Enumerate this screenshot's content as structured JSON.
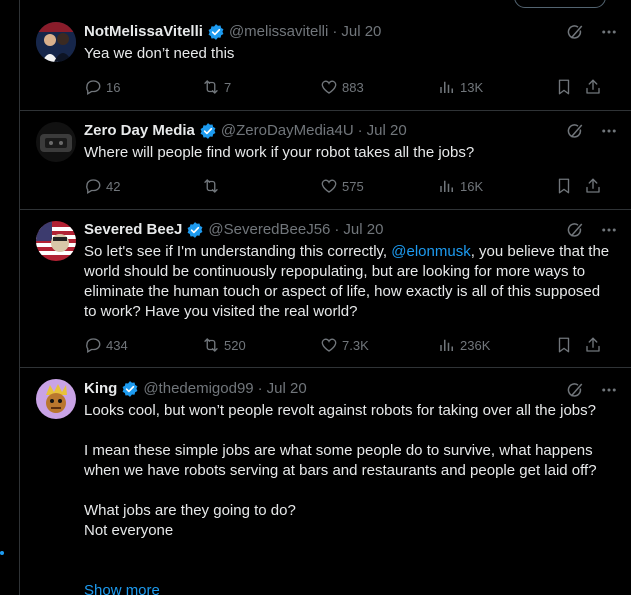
{
  "tweets": [
    {
      "name": "NotMelissaVitelli",
      "handle": "@melissavitelli",
      "date": "Jul 20",
      "text": "Yea we don’t need this",
      "replies": "16",
      "reposts": "7",
      "likes": "883",
      "views": "13K"
    },
    {
      "name": "Zero Day Media",
      "handle": "@ZeroDayMedia4U",
      "date": "Jul 20",
      "text": "Where will people find work if your robot takes all the jobs?",
      "replies": "42",
      "reposts": "",
      "likes": "575",
      "views": "16K"
    },
    {
      "name": "Severed BeeJ",
      "handle": "@SeveredBeeJ56",
      "date": "Jul 20",
      "text_before": "So let's see if I'm understanding this correctly, ",
      "mention": "@elonmusk",
      "text_after": ", you believe that the world should be continuously repopulating, but are looking for more ways to eliminate the human touch or aspect of life, how exactly is all of this supposed to work? Have you visited the real world?",
      "replies": "434",
      "reposts": "520",
      "likes": "7.3K",
      "views": "236K"
    },
    {
      "name": "King",
      "handle": "@thedemigod99",
      "date": "Jul 20",
      "text": "Looks cool, but won’t people revolt against robots for taking over all the jobs?\n\nI mean these simple jobs are what some people do to survive, what happens when we have robots serving at bars and restaurants and people get laid off?\n\nWhat jobs are they going to do?\nNot everyone",
      "show_more": "Show more"
    }
  ],
  "separator": "·",
  "icons": {
    "verified": "verified-badge-icon",
    "grok": "grok-icon",
    "more": "more-icon",
    "reply": "reply-icon",
    "repost": "repost-icon",
    "like": "like-icon",
    "views": "views-icon",
    "bookmark": "bookmark-icon",
    "share": "share-icon"
  },
  "colors": {
    "background": "#000000",
    "text": "#e7e9ea",
    "muted": "#71767b",
    "accent": "#1d9bf0",
    "border": "#2f3336"
  }
}
